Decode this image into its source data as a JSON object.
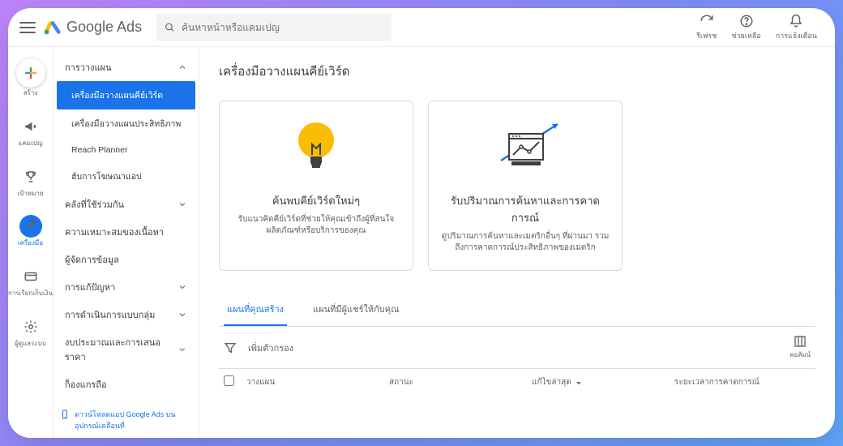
{
  "topbar": {
    "product_name": "Google Ads",
    "search_placeholder": "ค้นหาหน้าหรือแคมเปญ",
    "actions": [
      {
        "label": "รีเฟรช"
      },
      {
        "label": "ช่วยเหลือ"
      },
      {
        "label": "การแจ้งเตือน"
      }
    ]
  },
  "rail": {
    "create": "สร้าง",
    "campaigns": "แคมเปญ",
    "goals": "เป้าหมาย",
    "tools": "เครื่องมือ",
    "billing": "การเรียกเก็บเงิน",
    "admin": "ผู้ดูแลระบบ"
  },
  "sidepanel": {
    "groups": [
      {
        "header": "การวางแผน",
        "expanded": true,
        "items": [
          "เครื่องมือวางแผนคีย์เวิร์ด",
          "เครื่องมือวางแผนประสิทธิภาพ",
          "Reach Planner",
          "ฮับการโฆษณาแอป"
        ]
      },
      {
        "header": "คลังที่ใช้ร่วมกัน"
      },
      {
        "header": "ความเหมาะสมของเนื้อหา"
      },
      {
        "header": "ผู้จัดการข้อมูล"
      },
      {
        "header": "การแก้ปัญหา"
      },
      {
        "header": "การดำเนินการแบบกลุ่ม"
      },
      {
        "header": "งบประมาณและการเสนอราคา"
      },
      {
        "header": "ก็องแกรถือ"
      }
    ],
    "promo": "ดาวน์โหลดแอป Google Ads บนอุปกรณ์เคลื่อนที่"
  },
  "main": {
    "title": "เครื่องมือวางแผนคีย์เวิร์ด",
    "cards": [
      {
        "title": "ค้นพบคีย์เวิร์ดใหม่ๆ",
        "desc": "รับแนวคิดคีย์เวิร์ดที่ช่วยให้คุณเข้าถึงผู้ที่สนใจผลิตภัณฑ์หรือบริการของคุณ"
      },
      {
        "title": "รับปริมาณการค้นหาและการคาดการณ์",
        "desc": "ดูปริมาณการค้นหาและเมตริกอื่นๆ ที่ผ่านมา รวมถึงการคาดการณ์ประสิทธิภาพของเมตริก"
      }
    ],
    "tabs": [
      "แผนที่คุณสร้าง",
      "แผนที่มีผู้แชร์ให้กับคุณ"
    ],
    "filter_label": "เพิ่มตัวกรอง",
    "columns_label": "คอลัมน์",
    "table_headers": [
      "วางแผน",
      "สถานะ",
      "แก้ไขล่าสุด",
      "ระยะเวลาการคาดการณ์"
    ]
  }
}
